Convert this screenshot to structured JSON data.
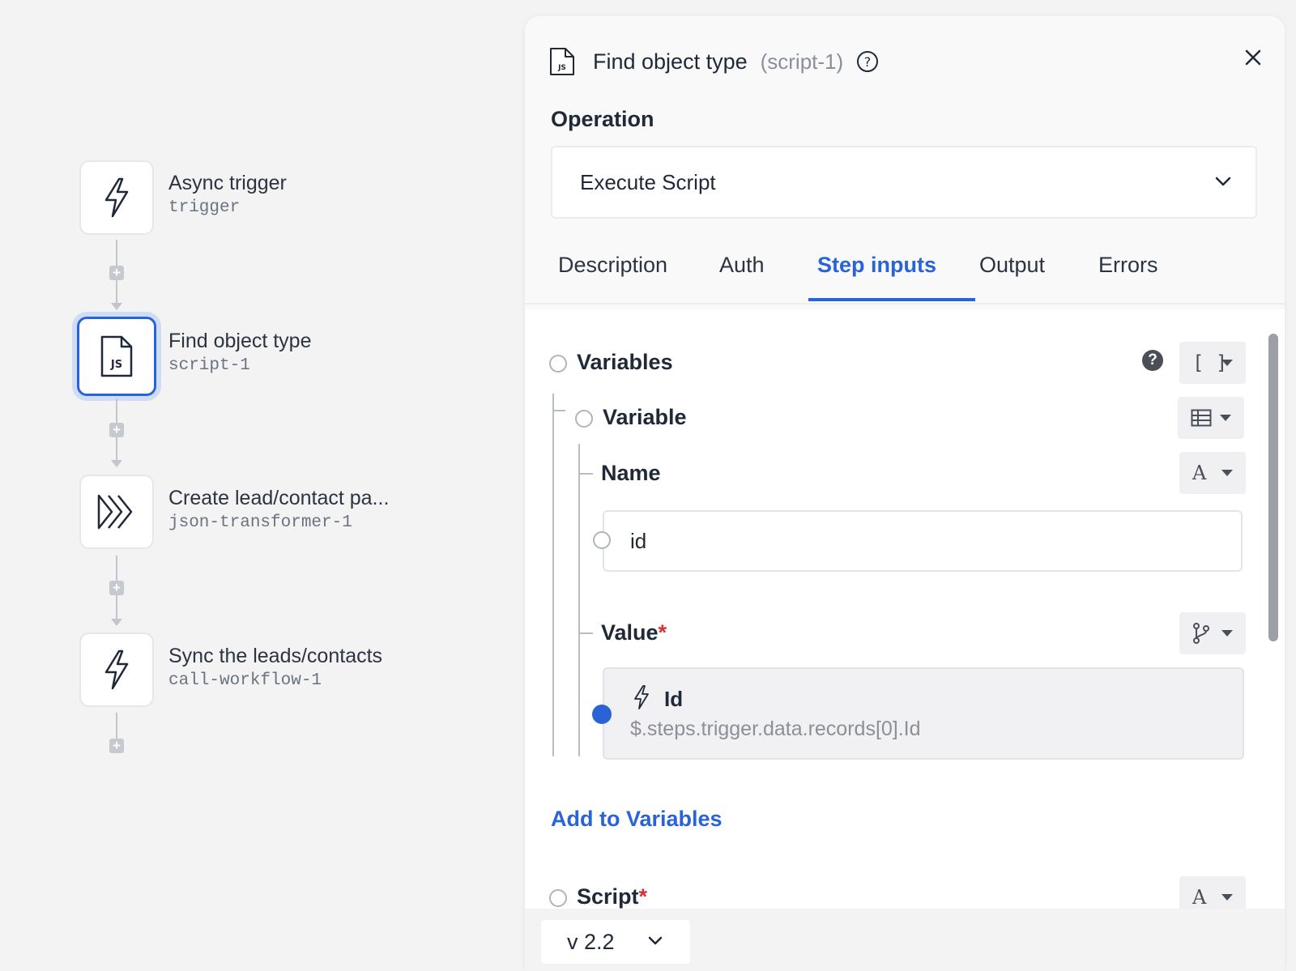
{
  "workflow": {
    "steps": [
      {
        "title": "Async trigger",
        "id": "trigger",
        "icon": "lightning-icon"
      },
      {
        "title": "Find object type",
        "id": "script-1",
        "icon": "js-file-icon",
        "selected": true
      },
      {
        "title": "Create lead/contact pa...",
        "id": "json-transformer-1",
        "icon": "chevrons-right-icon"
      },
      {
        "title": "Sync the leads/contacts",
        "id": "call-workflow-1",
        "icon": "lightning-icon"
      }
    ],
    "add_step_glyph": "+"
  },
  "panel": {
    "title": "Find object type",
    "subtitle": "(script-1)",
    "help_glyph": "?",
    "operation_label": "Operation",
    "operation_value": "Execute Script",
    "tabs": [
      {
        "label": "Description",
        "active": false
      },
      {
        "label": "Auth",
        "active": false
      },
      {
        "label": "Step inputs",
        "active": true
      },
      {
        "label": "Output",
        "active": false
      },
      {
        "label": "Errors",
        "active": false
      }
    ],
    "inputs": {
      "variables_label": "Variables",
      "variables_type_glyph": "[ ]",
      "help_glyph": "?",
      "variable_label": "Variable",
      "name_label": "Name",
      "name_type_glyph": "A",
      "name_value": "id",
      "value_label": "Value",
      "required_mark": "*",
      "value_title": "Id",
      "value_path": "$.steps.trigger.data.records[0].Id",
      "add_link": "Add to Variables",
      "script_label": "Script",
      "script_type_glyph": "A"
    },
    "version": "v 2.2"
  },
  "colors": {
    "accent": "#2a63d6",
    "required": "#d93030",
    "canvas_bg": "#f3f3f4"
  }
}
